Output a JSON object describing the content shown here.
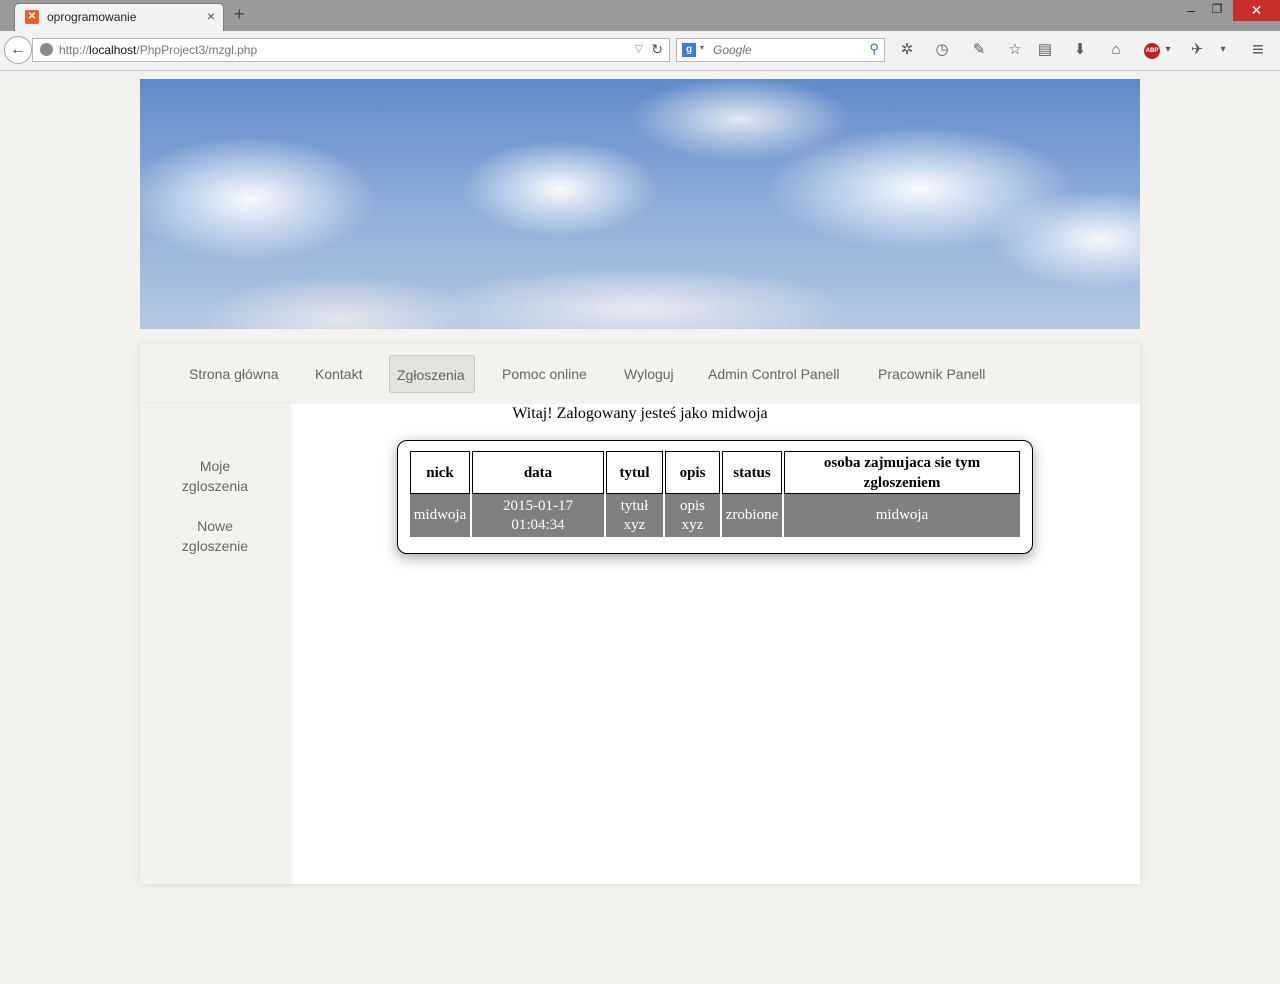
{
  "browser": {
    "tab_title": "oprogramowanie",
    "tab_close": "×",
    "new_tab": "+",
    "url_prefix": "http://",
    "url_host": "localhost",
    "url_path": "/PhpProject3/mzgl.php",
    "search_placeholder": "Google",
    "window_controls": {
      "minimize": "–",
      "restore": "❐",
      "close": "✕"
    }
  },
  "icons": {
    "back": "←",
    "reload": "↻",
    "dropdown": "▽",
    "search_go": "⚲",
    "gear": "✲",
    "history": "◷",
    "tools": "✎",
    "bookmark": "☆",
    "reader": "▤",
    "download": "⬇",
    "home": "⌂",
    "abp": "ABP",
    "extension": "✈",
    "menu": "≡",
    "more": "▾"
  },
  "menu": {
    "items": [
      "Strona główna",
      "Kontakt",
      "Zgłoszenia",
      "Pomoc online",
      "Wyloguj",
      "Admin Control Panell",
      "Pracownik Panell"
    ],
    "active_index": 2
  },
  "sidebar": {
    "items": [
      "Moje\nzgloszenia",
      "Nowe\nzgloszenie"
    ]
  },
  "welcome": "Witaj! Zalogowany jesteś jako midwoja",
  "table": {
    "headers": [
      "nick",
      "data",
      "tytul",
      "opis",
      "status",
      "osoba zajmujaca sie tym zgloszeniem"
    ],
    "rows": [
      [
        "midwoja",
        "2015-01-17 01:04:34",
        "tytuł xyz",
        "opis xyz",
        "zrobione",
        "midwoja"
      ]
    ]
  },
  "colors": {
    "page_bg": "#f3f2ef",
    "row_bg": "#808080",
    "menu_active_bg": "#e3e2df"
  }
}
